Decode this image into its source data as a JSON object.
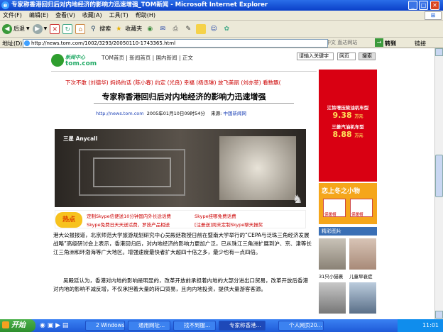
{
  "window": {
    "title": "专家称香港回归后对内地经济的影响力迅速增强_TOM新闻 - Microsoft Internet Explorer",
    "min": "_",
    "max": "□",
    "close": "✕"
  },
  "menu": [
    "文件(F)",
    "编辑(E)",
    "查看(V)",
    "收藏(A)",
    "工具(T)",
    "帮助(H)"
  ],
  "toolbar": {
    "back": "后退",
    "search": "搜索",
    "favorites": "收藏夹",
    "input_cn": "输入中文 直达网站"
  },
  "address": {
    "label": "地址(D)",
    "url": "http://news.tom.com/1002/3293/20050110-1743365.html",
    "go": "转到",
    "links": "链接"
  },
  "site": {
    "logo_cn": "新闻中心",
    "logo_en": "tom.com",
    "breadcrumb": [
      "TOM首页",
      "新闻首页",
      "国内新闻",
      "正文"
    ],
    "search_placeholder": "请输入关键字",
    "search_select": "网页",
    "search_btn": "搜索",
    "ticker": "下次不敢 (刘德华)   妈妈的话 (陈小春)   约定 (光良)   幸福 (杨丞琳)   放飞美丽 (刘亦菲)   看数飘(",
    "headline": "专家称香港回归后对内地经济的影响力迅速增强",
    "meta_url": "http://news.tom.com",
    "meta_date": "2005年01月10日09时54分",
    "meta_source_label": "来源:",
    "meta_source": "中国新闻网",
    "ad_brand": "三星 Anycall",
    "hot_label": "热点",
    "promo": [
      "定制Skype信便送10分钟国内外长途话费",
      "Skype挂哪免费话费",
      "Skype免费日天天送话费，罗技产品相送",
      "[注册送]周末定制Skype聊天报奖"
    ],
    "body_p1": "港大公报报道，北京师范大学旅游规划研究中心吴殿廷教授日前在暨南大学举行的“CEPA与泛珠三角经济发展战略”高级研讨会上表示，香港回归后，对内地经济的影响力更加广泛，已从珠江三角洲扩展到沪、京、津等长江三角洲和环渤海等广大地区。增强速度最快者扩大超四十倍之多，最少也有一点四倍。",
    "body_p2": "吴殿廷认为，香港对内地的影响是明显的，改革开放前承担着内地的大部分进出口贸易，改革开放后香港对内地的影响不减反增，不仅承担着大量的转口贸易，且向内地投资，提供大量游客客源。",
    "right_ad1_l1": "江铃增压柴油机车型",
    "right_ad1_v1": "9.38",
    "right_ad1_u1": "万元",
    "right_ad1_l2": "三菱汽油机车型",
    "right_ad1_v2": "8.88",
    "right_ad1_u2": "万元",
    "right_ad2": "恋上冬之小物",
    "right_ad2_sub1": "保暖帽",
    "right_ad2_sub2": "保暖帽",
    "pics_title": "精彩图片",
    "pic_caps": [
      "31只小猫裹",
      "儿童早衰症"
    ]
  },
  "taskbar": {
    "start": "开始",
    "tasks": [
      "2 Windows...",
      "通用网址...",
      "找不到服...",
      "专家称香港...",
      "个人网页20..."
    ],
    "clock": "11:01"
  },
  "colors": {
    "title_blue": "#0a3fc9",
    "accent_red": "#cc0000",
    "ad_red": "#d90012",
    "taskbar": "#245edb"
  }
}
